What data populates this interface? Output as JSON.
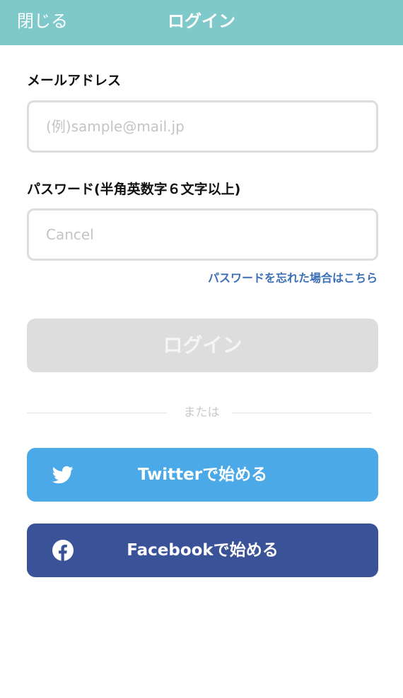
{
  "header": {
    "close_label": "閉じる",
    "title": "ログイン",
    "background_color": "#7fc9ca"
  },
  "email": {
    "label": "メールアドレス",
    "placeholder": "(例)sample@mail.jp",
    "value": ""
  },
  "password": {
    "label": "パスワード(半角英数字６文字以上)",
    "placeholder": "Cancel",
    "value": ""
  },
  "forgot_password_link": "パスワードを忘れた場合はこちら",
  "login_button": {
    "label": "ログイン",
    "state": "disabled"
  },
  "divider_text": "または",
  "social": {
    "twitter": {
      "label": "Twitterで始める",
      "icon": "twitter-bird-icon",
      "color": "#4aa9e6"
    },
    "facebook": {
      "label": "Facebookで始める",
      "icon": "facebook-icon",
      "color": "#3a5297"
    }
  },
  "colors": {
    "link": "#3b6fb6",
    "disabled_button": "#dddddd",
    "input_border": "#dddddd"
  }
}
